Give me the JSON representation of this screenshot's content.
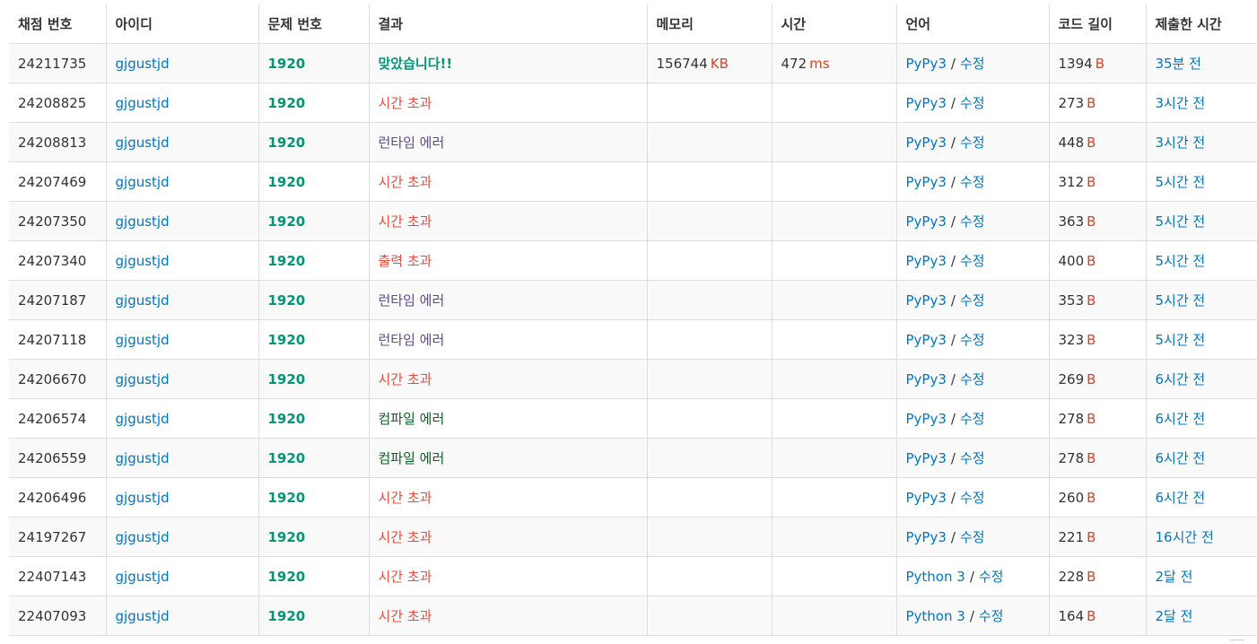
{
  "colors": {
    "link": "#0076c0",
    "accepted": "#009874",
    "time_limit": "#e74c3c",
    "runtime_error": "#5f4b8b",
    "output_limit": "#e74c3c",
    "compile_error": "#0b6121",
    "unit": "#dd4124"
  },
  "headers": [
    "채점 번호",
    "아이디",
    "문제 번호",
    "결과",
    "메모리",
    "시간",
    "언어",
    "코드 길이",
    "제출한 시간"
  ],
  "edit_label": "수정",
  "rows": [
    {
      "id": "24211735",
      "user": "gjgustjd",
      "problem": "1920",
      "result": "맞았습니다!!",
      "result_type": "ac",
      "memory": "156744",
      "memory_unit": "KB",
      "time": "472",
      "time_unit": "ms",
      "language": "PyPy3",
      "edit": "수정",
      "length": "1394",
      "length_unit": "B",
      "submitted": "35분 전"
    },
    {
      "id": "24208825",
      "user": "gjgustjd",
      "problem": "1920",
      "result": "시간 초과",
      "result_type": "tle",
      "memory": "",
      "memory_unit": "",
      "time": "",
      "time_unit": "",
      "language": "PyPy3",
      "edit": "수정",
      "length": "273",
      "length_unit": "B",
      "submitted": "3시간 전"
    },
    {
      "id": "24208813",
      "user": "gjgustjd",
      "problem": "1920",
      "result": "런타임 에러",
      "result_type": "rte",
      "memory": "",
      "memory_unit": "",
      "time": "",
      "time_unit": "",
      "language": "PyPy3",
      "edit": "수정",
      "length": "448",
      "length_unit": "B",
      "submitted": "3시간 전"
    },
    {
      "id": "24207469",
      "user": "gjgustjd",
      "problem": "1920",
      "result": "시간 초과",
      "result_type": "tle",
      "memory": "",
      "memory_unit": "",
      "time": "",
      "time_unit": "",
      "language": "PyPy3",
      "edit": "수정",
      "length": "312",
      "length_unit": "B",
      "submitted": "5시간 전"
    },
    {
      "id": "24207350",
      "user": "gjgustjd",
      "problem": "1920",
      "result": "시간 초과",
      "result_type": "tle",
      "memory": "",
      "memory_unit": "",
      "time": "",
      "time_unit": "",
      "language": "PyPy3",
      "edit": "수정",
      "length": "363",
      "length_unit": "B",
      "submitted": "5시간 전"
    },
    {
      "id": "24207340",
      "user": "gjgustjd",
      "problem": "1920",
      "result": "출력 초과",
      "result_type": "ole",
      "memory": "",
      "memory_unit": "",
      "time": "",
      "time_unit": "",
      "language": "PyPy3",
      "edit": "수정",
      "length": "400",
      "length_unit": "B",
      "submitted": "5시간 전"
    },
    {
      "id": "24207187",
      "user": "gjgustjd",
      "problem": "1920",
      "result": "런타임 에러",
      "result_type": "rte",
      "memory": "",
      "memory_unit": "",
      "time": "",
      "time_unit": "",
      "language": "PyPy3",
      "edit": "수정",
      "length": "353",
      "length_unit": "B",
      "submitted": "5시간 전"
    },
    {
      "id": "24207118",
      "user": "gjgustjd",
      "problem": "1920",
      "result": "런타임 에러",
      "result_type": "rte",
      "memory": "",
      "memory_unit": "",
      "time": "",
      "time_unit": "",
      "language": "PyPy3",
      "edit": "수정",
      "length": "323",
      "length_unit": "B",
      "submitted": "5시간 전"
    },
    {
      "id": "24206670",
      "user": "gjgustjd",
      "problem": "1920",
      "result": "시간 초과",
      "result_type": "tle",
      "memory": "",
      "memory_unit": "",
      "time": "",
      "time_unit": "",
      "language": "PyPy3",
      "edit": "수정",
      "length": "269",
      "length_unit": "B",
      "submitted": "6시간 전"
    },
    {
      "id": "24206574",
      "user": "gjgustjd",
      "problem": "1920",
      "result": "컴파일 에러",
      "result_type": "ce",
      "memory": "",
      "memory_unit": "",
      "time": "",
      "time_unit": "",
      "language": "PyPy3",
      "edit": "수정",
      "length": "278",
      "length_unit": "B",
      "submitted": "6시간 전"
    },
    {
      "id": "24206559",
      "user": "gjgustjd",
      "problem": "1920",
      "result": "컴파일 에러",
      "result_type": "ce",
      "memory": "",
      "memory_unit": "",
      "time": "",
      "time_unit": "",
      "language": "PyPy3",
      "edit": "수정",
      "length": "278",
      "length_unit": "B",
      "submitted": "6시간 전"
    },
    {
      "id": "24206496",
      "user": "gjgustjd",
      "problem": "1920",
      "result": "시간 초과",
      "result_type": "tle",
      "memory": "",
      "memory_unit": "",
      "time": "",
      "time_unit": "",
      "language": "PyPy3",
      "edit": "수정",
      "length": "260",
      "length_unit": "B",
      "submitted": "6시간 전"
    },
    {
      "id": "24197267",
      "user": "gjgustjd",
      "problem": "1920",
      "result": "시간 초과",
      "result_type": "tle",
      "memory": "",
      "memory_unit": "",
      "time": "",
      "time_unit": "",
      "language": "PyPy3",
      "edit": "수정",
      "length": "221",
      "length_unit": "B",
      "submitted": "16시간 전"
    },
    {
      "id": "22407143",
      "user": "gjgustjd",
      "problem": "1920",
      "result": "시간 초과",
      "result_type": "tle",
      "memory": "",
      "memory_unit": "",
      "time": "",
      "time_unit": "",
      "language": "Python 3",
      "edit": "수정",
      "length": "228",
      "length_unit": "B",
      "submitted": "2달 전"
    },
    {
      "id": "22407093",
      "user": "gjgustjd",
      "problem": "1920",
      "result": "시간 초과",
      "result_type": "tle",
      "memory": "",
      "memory_unit": "",
      "time": "",
      "time_unit": "",
      "language": "Python 3",
      "edit": "수정",
      "length": "164",
      "length_unit": "B",
      "submitted": "2달 전"
    }
  ]
}
